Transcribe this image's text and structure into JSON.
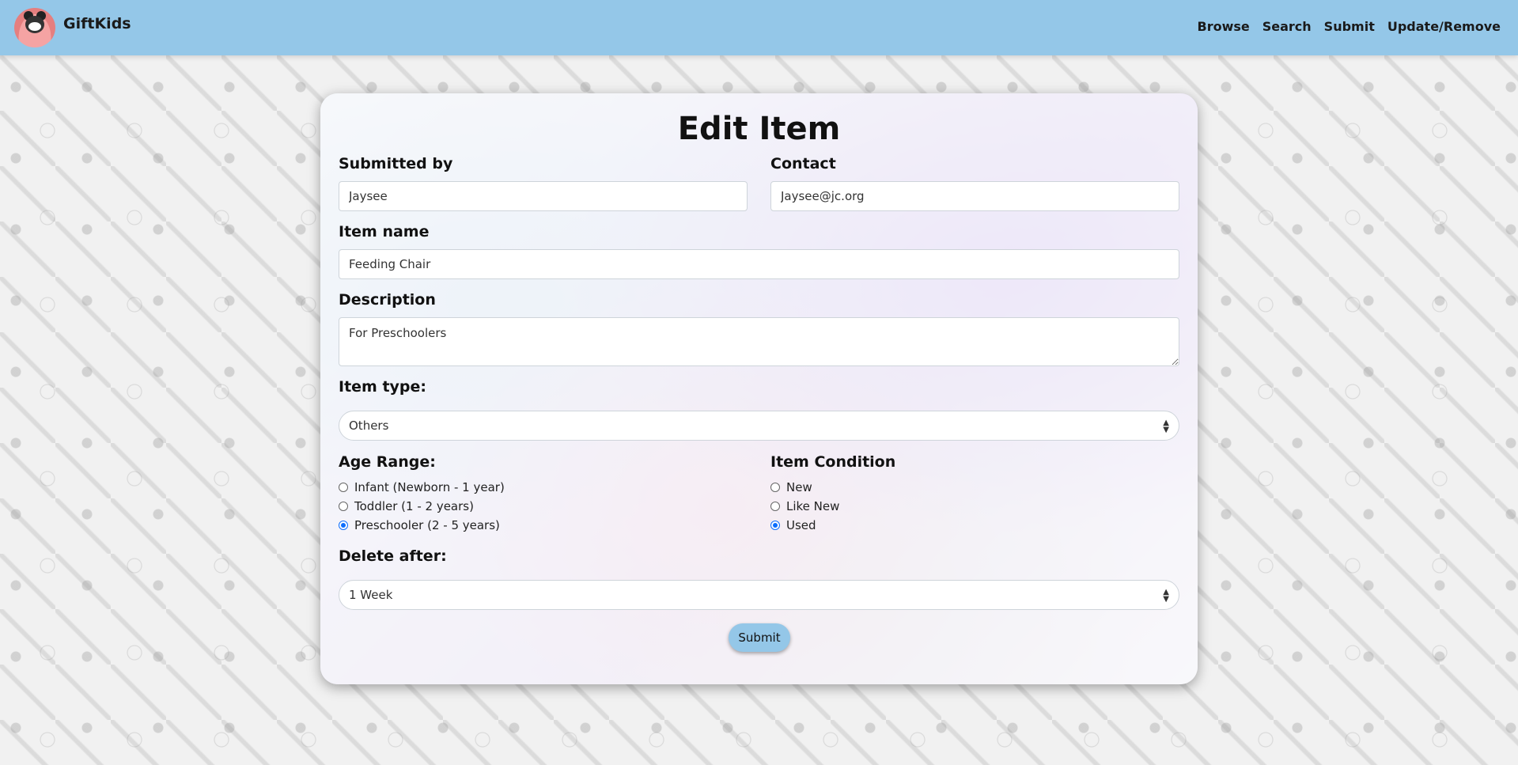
{
  "nav": {
    "brand": "GiftKids",
    "links": [
      "Browse",
      "Search",
      "Submit",
      "Update/Remove"
    ]
  },
  "form": {
    "title": "Edit Item",
    "submitted_by": {
      "label": "Submitted by",
      "value": "Jaysee"
    },
    "contact": {
      "label": "Contact",
      "value": "Jaysee@jc.org"
    },
    "item_name": {
      "label": "Item name",
      "value": "Feeding Chair"
    },
    "description": {
      "label": "Description",
      "value": "For Preschoolers"
    },
    "item_type": {
      "label": "Item type:",
      "selected": "Others"
    },
    "age_range": {
      "label": "Age Range:",
      "options": [
        "Infant (Newborn - 1 year)",
        "Toddler (1 - 2 years)",
        "Preschooler (2 - 5 years)"
      ],
      "selected": "Preschooler (2 - 5 years)"
    },
    "item_condition": {
      "label": "Item Condition",
      "options": [
        "New",
        "Like New",
        "Used"
      ],
      "selected": "Used"
    },
    "delete_after": {
      "label": "Delete after:",
      "selected": "1 Week"
    },
    "submit_label": "Submit"
  },
  "colors": {
    "navbar": "#94c7e8",
    "radio_checked": "#0d6efd"
  }
}
